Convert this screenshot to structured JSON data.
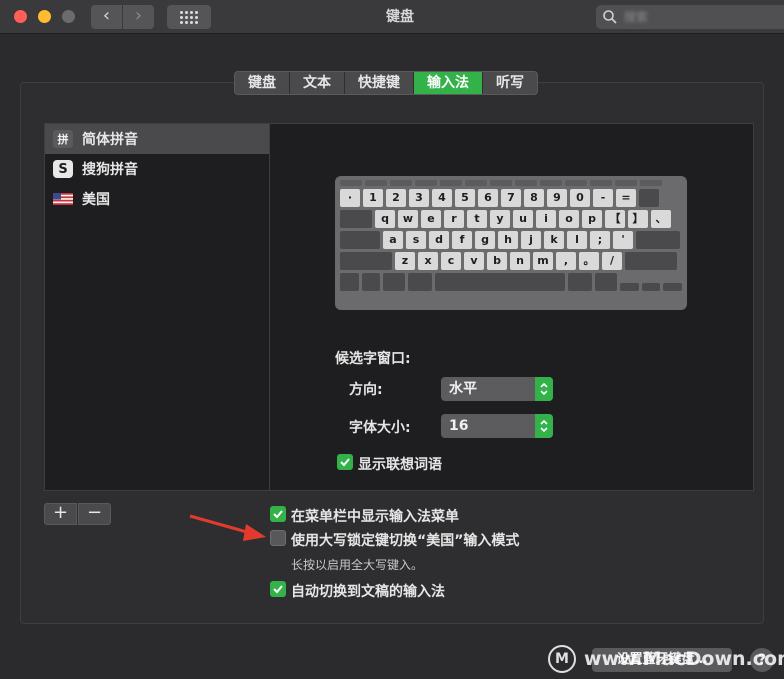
{
  "window": {
    "title": "键盘",
    "search_placeholder": "搜索"
  },
  "tabs": [
    {
      "label": "键盘",
      "active": false
    },
    {
      "label": "文本",
      "active": false
    },
    {
      "label": "快捷键",
      "active": false
    },
    {
      "label": "输入法",
      "active": true
    },
    {
      "label": "听写",
      "active": false
    }
  ],
  "input_sources": [
    {
      "icon": "pinyin-icon",
      "glyph": "拼",
      "label": "简体拼音",
      "selected": true
    },
    {
      "icon": "sogou-icon",
      "glyph": "S",
      "label": "搜狗拼音",
      "selected": false
    },
    {
      "icon": "us-flag-icon",
      "glyph": "",
      "label": "美国",
      "selected": false
    }
  ],
  "keyboard": {
    "row1": [
      "·",
      "1",
      "2",
      "3",
      "4",
      "5",
      "6",
      "7",
      "8",
      "9",
      "0",
      "-",
      "="
    ],
    "row2": [
      "q",
      "w",
      "e",
      "r",
      "t",
      "y",
      "u",
      "i",
      "o",
      "p",
      "【",
      "】",
      "、"
    ],
    "row3": [
      "a",
      "s",
      "d",
      "f",
      "g",
      "h",
      "j",
      "k",
      "l",
      ";",
      "'"
    ],
    "row4": [
      "z",
      "x",
      "c",
      "v",
      "b",
      "n",
      "m",
      ",",
      "。",
      "/"
    ]
  },
  "candidate_window": {
    "heading": "候选字窗口:",
    "direction_label": "方向:",
    "direction_value": "水平",
    "font_size_label": "字体大小:",
    "font_size_value": "16",
    "show_predictions_label": "显示联想词语",
    "show_predictions_checked": true
  },
  "options": {
    "show_in_menu_bar": {
      "label": "在菜单栏中显示输入法菜单",
      "checked": true
    },
    "caps_lock_switch": {
      "label": "使用大写锁定键切换“美国”输入模式",
      "checked": false
    },
    "caps_lock_hint": "长按以启用全大写键入。",
    "auto_switch": {
      "label": "自动切换到文稿的输入法",
      "checked": true
    }
  },
  "buttons": {
    "add": "+",
    "remove": "−",
    "bluetooth_keyboard": "设置蓝牙键盘…",
    "help": "?"
  },
  "watermark": {
    "logo": "M",
    "text": "www.MacDown.com"
  },
  "colors": {
    "accent": "#33b249",
    "arrow": "#e23b2e"
  }
}
